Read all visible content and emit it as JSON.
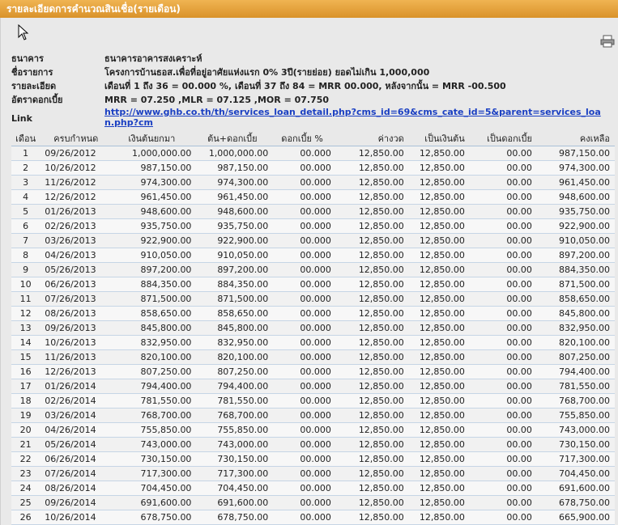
{
  "window": {
    "title": "รายละเอียดการคำนวณสินเชื่อ(รายเดือน)"
  },
  "icons": {
    "cursor": "mouse-pointer-icon",
    "print": "printer-icon"
  },
  "info": {
    "bank": {
      "label": "ธนาคาร",
      "value": "ธนาคารอาคารสงเคราะห์"
    },
    "project": {
      "label": "ชื่อรายการ",
      "value": "โครงการบ้านธอส.เพื่อที่อยู่อาศัยแห่งแรก 0% 3ปี(รายย่อย) ยอดไม่เกิน 1,000,000"
    },
    "detail": {
      "label": "รายละเอียด",
      "value": "เดือนที่ 1 ถึง 36 = 00.000 %, เดือนที่ 37 ถึง 84 = MRR 00.000, หลังจากนั้น = MRR -00.500"
    },
    "rate": {
      "label": "อัตราดอกเบี้ย",
      "value": "MRR = 07.250 ,MLR = 07.125 ,MOR = 07.750"
    },
    "link": {
      "label": "Link",
      "value": "http://www.ghb.co.th/th/services_loan_detail.php?cms_id=69&cms_cate_id=5&parent=services_loan.php?cm"
    }
  },
  "table": {
    "headers": [
      "เดือน",
      "ครบกำหนด",
      "เงินต้นยกมา",
      "ต้น+ดอกเบี้ย",
      "ดอกเบี้ย %",
      "ค่างวด",
      "เป็นเงินต้น",
      "เป็นดอกเบี้ย",
      "คงเหลือ"
    ],
    "rows": [
      [
        "1",
        "09/26/2012",
        "1,000,000.00",
        "1,000,000.00",
        "00.000",
        "12,850.00",
        "12,850.00",
        "00.00",
        "987,150.00"
      ],
      [
        "2",
        "10/26/2012",
        "987,150.00",
        "987,150.00",
        "00.000",
        "12,850.00",
        "12,850.00",
        "00.00",
        "974,300.00"
      ],
      [
        "3",
        "11/26/2012",
        "974,300.00",
        "974,300.00",
        "00.000",
        "12,850.00",
        "12,850.00",
        "00.00",
        "961,450.00"
      ],
      [
        "4",
        "12/26/2012",
        "961,450.00",
        "961,450.00",
        "00.000",
        "12,850.00",
        "12,850.00",
        "00.00",
        "948,600.00"
      ],
      [
        "5",
        "01/26/2013",
        "948,600.00",
        "948,600.00",
        "00.000",
        "12,850.00",
        "12,850.00",
        "00.00",
        "935,750.00"
      ],
      [
        "6",
        "02/26/2013",
        "935,750.00",
        "935,750.00",
        "00.000",
        "12,850.00",
        "12,850.00",
        "00.00",
        "922,900.00"
      ],
      [
        "7",
        "03/26/2013",
        "922,900.00",
        "922,900.00",
        "00.000",
        "12,850.00",
        "12,850.00",
        "00.00",
        "910,050.00"
      ],
      [
        "8",
        "04/26/2013",
        "910,050.00",
        "910,050.00",
        "00.000",
        "12,850.00",
        "12,850.00",
        "00.00",
        "897,200.00"
      ],
      [
        "9",
        "05/26/2013",
        "897,200.00",
        "897,200.00",
        "00.000",
        "12,850.00",
        "12,850.00",
        "00.00",
        "884,350.00"
      ],
      [
        "10",
        "06/26/2013",
        "884,350.00",
        "884,350.00",
        "00.000",
        "12,850.00",
        "12,850.00",
        "00.00",
        "871,500.00"
      ],
      [
        "11",
        "07/26/2013",
        "871,500.00",
        "871,500.00",
        "00.000",
        "12,850.00",
        "12,850.00",
        "00.00",
        "858,650.00"
      ],
      [
        "12",
        "08/26/2013",
        "858,650.00",
        "858,650.00",
        "00.000",
        "12,850.00",
        "12,850.00",
        "00.00",
        "845,800.00"
      ],
      [
        "13",
        "09/26/2013",
        "845,800.00",
        "845,800.00",
        "00.000",
        "12,850.00",
        "12,850.00",
        "00.00",
        "832,950.00"
      ],
      [
        "14",
        "10/26/2013",
        "832,950.00",
        "832,950.00",
        "00.000",
        "12,850.00",
        "12,850.00",
        "00.00",
        "820,100.00"
      ],
      [
        "15",
        "11/26/2013",
        "820,100.00",
        "820,100.00",
        "00.000",
        "12,850.00",
        "12,850.00",
        "00.00",
        "807,250.00"
      ],
      [
        "16",
        "12/26/2013",
        "807,250.00",
        "807,250.00",
        "00.000",
        "12,850.00",
        "12,850.00",
        "00.00",
        "794,400.00"
      ],
      [
        "17",
        "01/26/2014",
        "794,400.00",
        "794,400.00",
        "00.000",
        "12,850.00",
        "12,850.00",
        "00.00",
        "781,550.00"
      ],
      [
        "18",
        "02/26/2014",
        "781,550.00",
        "781,550.00",
        "00.000",
        "12,850.00",
        "12,850.00",
        "00.00",
        "768,700.00"
      ],
      [
        "19",
        "03/26/2014",
        "768,700.00",
        "768,700.00",
        "00.000",
        "12,850.00",
        "12,850.00",
        "00.00",
        "755,850.00"
      ],
      [
        "20",
        "04/26/2014",
        "755,850.00",
        "755,850.00",
        "00.000",
        "12,850.00",
        "12,850.00",
        "00.00",
        "743,000.00"
      ],
      [
        "21",
        "05/26/2014",
        "743,000.00",
        "743,000.00",
        "00.000",
        "12,850.00",
        "12,850.00",
        "00.00",
        "730,150.00"
      ],
      [
        "22",
        "06/26/2014",
        "730,150.00",
        "730,150.00",
        "00.000",
        "12,850.00",
        "12,850.00",
        "00.00",
        "717,300.00"
      ],
      [
        "23",
        "07/26/2014",
        "717,300.00",
        "717,300.00",
        "00.000",
        "12,850.00",
        "12,850.00",
        "00.00",
        "704,450.00"
      ],
      [
        "24",
        "08/26/2014",
        "704,450.00",
        "704,450.00",
        "00.000",
        "12,850.00",
        "12,850.00",
        "00.00",
        "691,600.00"
      ],
      [
        "25",
        "09/26/2014",
        "691,600.00",
        "691,600.00",
        "00.000",
        "12,850.00",
        "12,850.00",
        "00.00",
        "678,750.00"
      ],
      [
        "26",
        "10/26/2014",
        "678,750.00",
        "678,750.00",
        "00.000",
        "12,850.00",
        "12,850.00",
        "00.00",
        "665,900.00"
      ]
    ]
  },
  "colors": {
    "title_bar": "#e8a43e",
    "panel": "#e9e9e9",
    "link": "#1a3fc2",
    "row_rule": "#c6d5e5"
  }
}
